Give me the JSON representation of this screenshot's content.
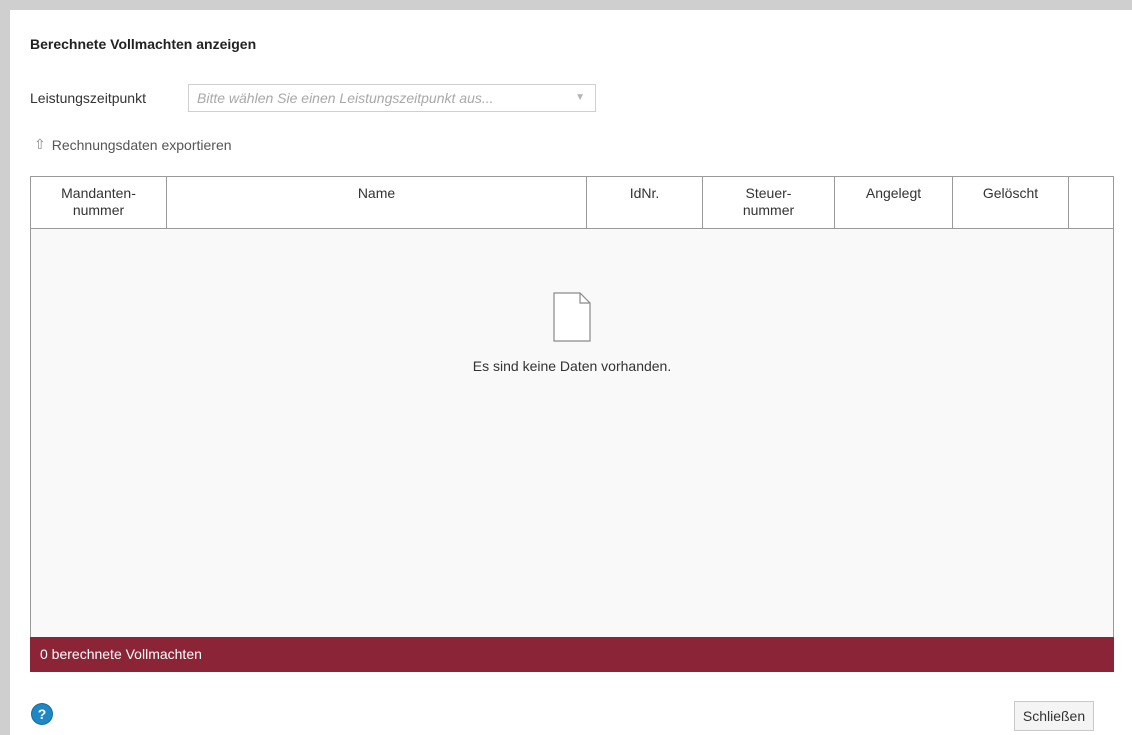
{
  "dialog": {
    "title": "Berechnete Vollmachten anzeigen"
  },
  "filter": {
    "label": "Leistungszeitpunkt",
    "placeholder": "Bitte wählen Sie einen Leistungszeitpunkt aus...",
    "dropdown_icon": "chevron-down-icon"
  },
  "export": {
    "icon": "arrow-up-icon",
    "label": "Rechnungsdaten exportieren"
  },
  "table": {
    "columns": [
      {
        "line1": "Mandanten-",
        "line2": "nummer"
      },
      {
        "line1": "Name",
        "line2": ""
      },
      {
        "line1": "IdNr.",
        "line2": ""
      },
      {
        "line1": "Steuer-",
        "line2": "nummer"
      },
      {
        "line1": "Angelegt",
        "line2": ""
      },
      {
        "line1": "Gelöscht",
        "line2": ""
      },
      {
        "line1": "",
        "line2": ""
      }
    ],
    "rows": [],
    "empty_icon": "document-icon",
    "empty_message": "Es sind keine Daten vorhanden."
  },
  "summary": {
    "text": "0 berechnete Vollmachten"
  },
  "footer": {
    "help_icon": "help-icon",
    "help_symbol": "?",
    "close_label": "Schließen"
  },
  "colors": {
    "summary_bar": "#8b2436",
    "help_icon": "#1e88c7"
  }
}
